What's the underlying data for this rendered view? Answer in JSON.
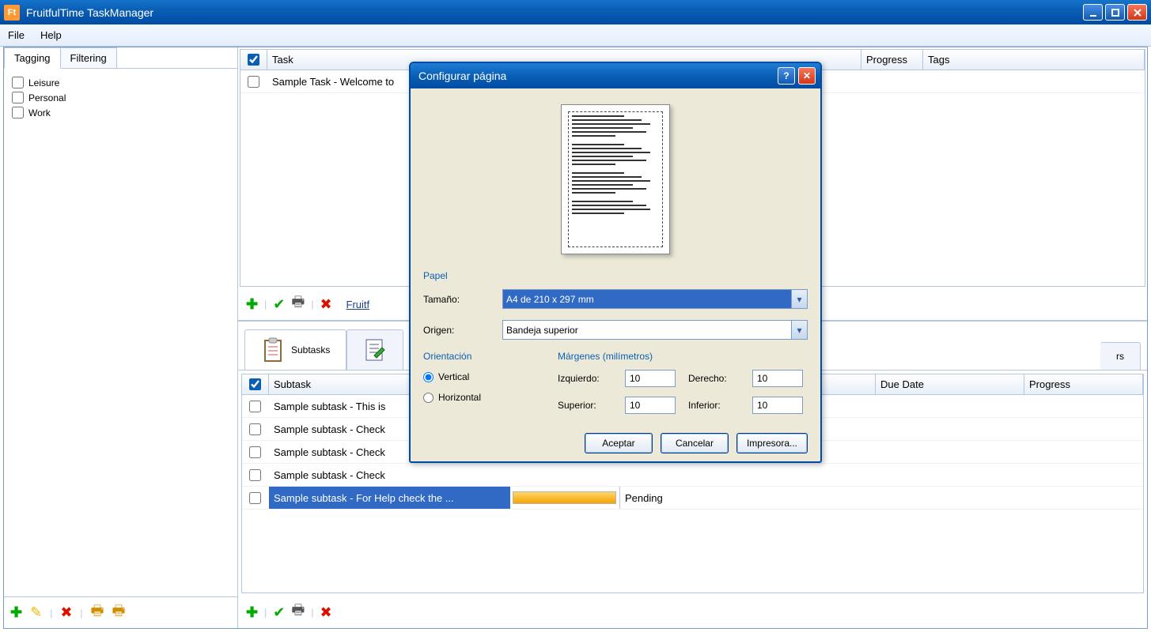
{
  "window": {
    "title": "FruitfulTime TaskManager"
  },
  "menu": {
    "file": "File",
    "help": "Help"
  },
  "sidebar": {
    "tabs": [
      "Tagging",
      "Filtering"
    ],
    "tags": [
      "Leisure",
      "Personal",
      "Work"
    ]
  },
  "tasks": {
    "headers": {
      "task": "Task",
      "progress": "Progress",
      "tags": "Tags"
    },
    "rows": [
      {
        "name": "Sample Task - Welcome to"
      }
    ],
    "link": "Fruitf"
  },
  "detail": {
    "tabs": {
      "subtasks": "Subtasks",
      "other": "rs"
    },
    "headers": {
      "subtask": "Subtask",
      "due": "Due Date",
      "progress": "Progress"
    },
    "rows": [
      {
        "name": "Sample subtask - This is",
        "status": ""
      },
      {
        "name": "Sample subtask - Check",
        "status": ""
      },
      {
        "name": "Sample subtask - Check",
        "status": ""
      },
      {
        "name": "Sample subtask - Check",
        "status": ""
      },
      {
        "name": "Sample subtask - For Help check the ...",
        "status": "Pending",
        "selected": true
      }
    ]
  },
  "dialog": {
    "title": "Configurar página",
    "paper": {
      "legend": "Papel",
      "size_label": "Tamaño:",
      "size_value": "A4 de 210 x 297 mm",
      "source_label": "Origen:",
      "source_value": "Bandeja superior"
    },
    "orientation": {
      "legend": "Orientación",
      "vertical": "Vertical",
      "horizontal": "Horizontal"
    },
    "margins": {
      "legend": "Márgenes (milímetros)",
      "left_label": "Izquierdo:",
      "right_label": "Derecho:",
      "top_label": "Superior:",
      "bottom_label": "Inferior:",
      "left": "10",
      "right": "10",
      "top": "10",
      "bottom": "10"
    },
    "buttons": {
      "accept": "Aceptar",
      "cancel": "Cancelar",
      "printer": "Impresora..."
    }
  }
}
